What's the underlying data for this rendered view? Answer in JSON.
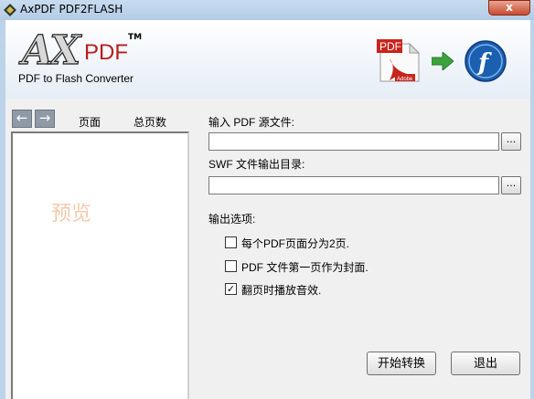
{
  "window": {
    "title": "AxPDF PDF2FLASH",
    "close_label": "x"
  },
  "brand": {
    "ax": "AX",
    "pdf": "PDF",
    "tm": "TM",
    "subtitle": "PDF to Flash Converter",
    "badge_pdf": "PDF",
    "badge_adobe": "Adobe",
    "flash_letter": "f"
  },
  "sidebar": {
    "prev_label": "←",
    "next_label": "→",
    "col_page": "页面",
    "col_total": "总页数",
    "preview_watermark": "预览"
  },
  "form": {
    "input_label": "输入 PDF 源文件:",
    "input_value": "",
    "input_browse": "...",
    "output_label": "SWF 文件输出目录:",
    "output_value": "",
    "output_browse": "...",
    "options_label": "输出选项:",
    "options": [
      {
        "label": "每个PDF页面分为2页.",
        "checked": false
      },
      {
        "label": "PDF 文件第一页作为封面.",
        "checked": false
      },
      {
        "label": "翻页时播放音效.",
        "checked": true
      }
    ]
  },
  "actions": {
    "start_label": "开始转换",
    "exit_label": "退出"
  },
  "colors": {
    "title_bar": "#bcd3ea",
    "close_red": "#c94a2f",
    "pdf_red": "#b71d1d",
    "flash_blue": "#1a5fb0",
    "arrow_green": "#3aa43a"
  }
}
